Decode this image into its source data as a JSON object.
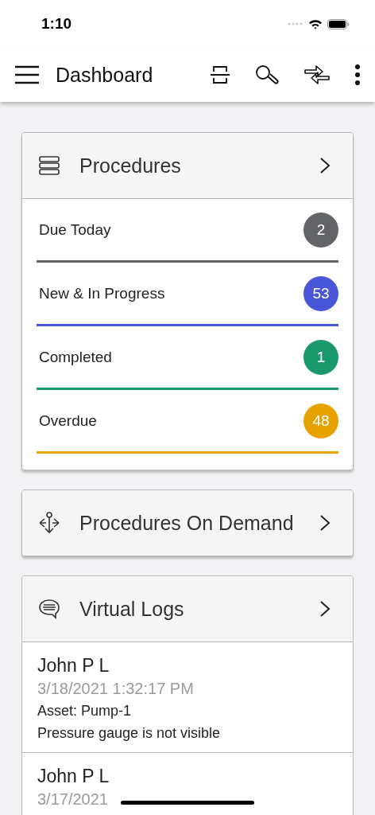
{
  "status_bar": {
    "time": "1:10"
  },
  "app_bar": {
    "title": "Dashboard"
  },
  "procedures": {
    "title": "Procedures",
    "items": [
      {
        "label": "Due Today",
        "count": "2",
        "color": "#636467"
      },
      {
        "label": "New & In Progress",
        "count": "53",
        "color": "#4a56d8"
      },
      {
        "label": "Completed",
        "count": "1",
        "color": "#1a9a6c"
      },
      {
        "label": "Overdue",
        "count": "48",
        "color": "#e5a200"
      }
    ]
  },
  "on_demand": {
    "title": "Procedures On Demand"
  },
  "virtual_logs": {
    "title": "Virtual Logs",
    "entries": [
      {
        "author": "John P L",
        "timestamp": "3/18/2021 1:32:17 PM",
        "lines": [
          "Asset: Pump-1",
          "Pressure gauge is not visible"
        ]
      },
      {
        "author": "John P L",
        "timestamp": "3/17/2021"
      }
    ]
  }
}
